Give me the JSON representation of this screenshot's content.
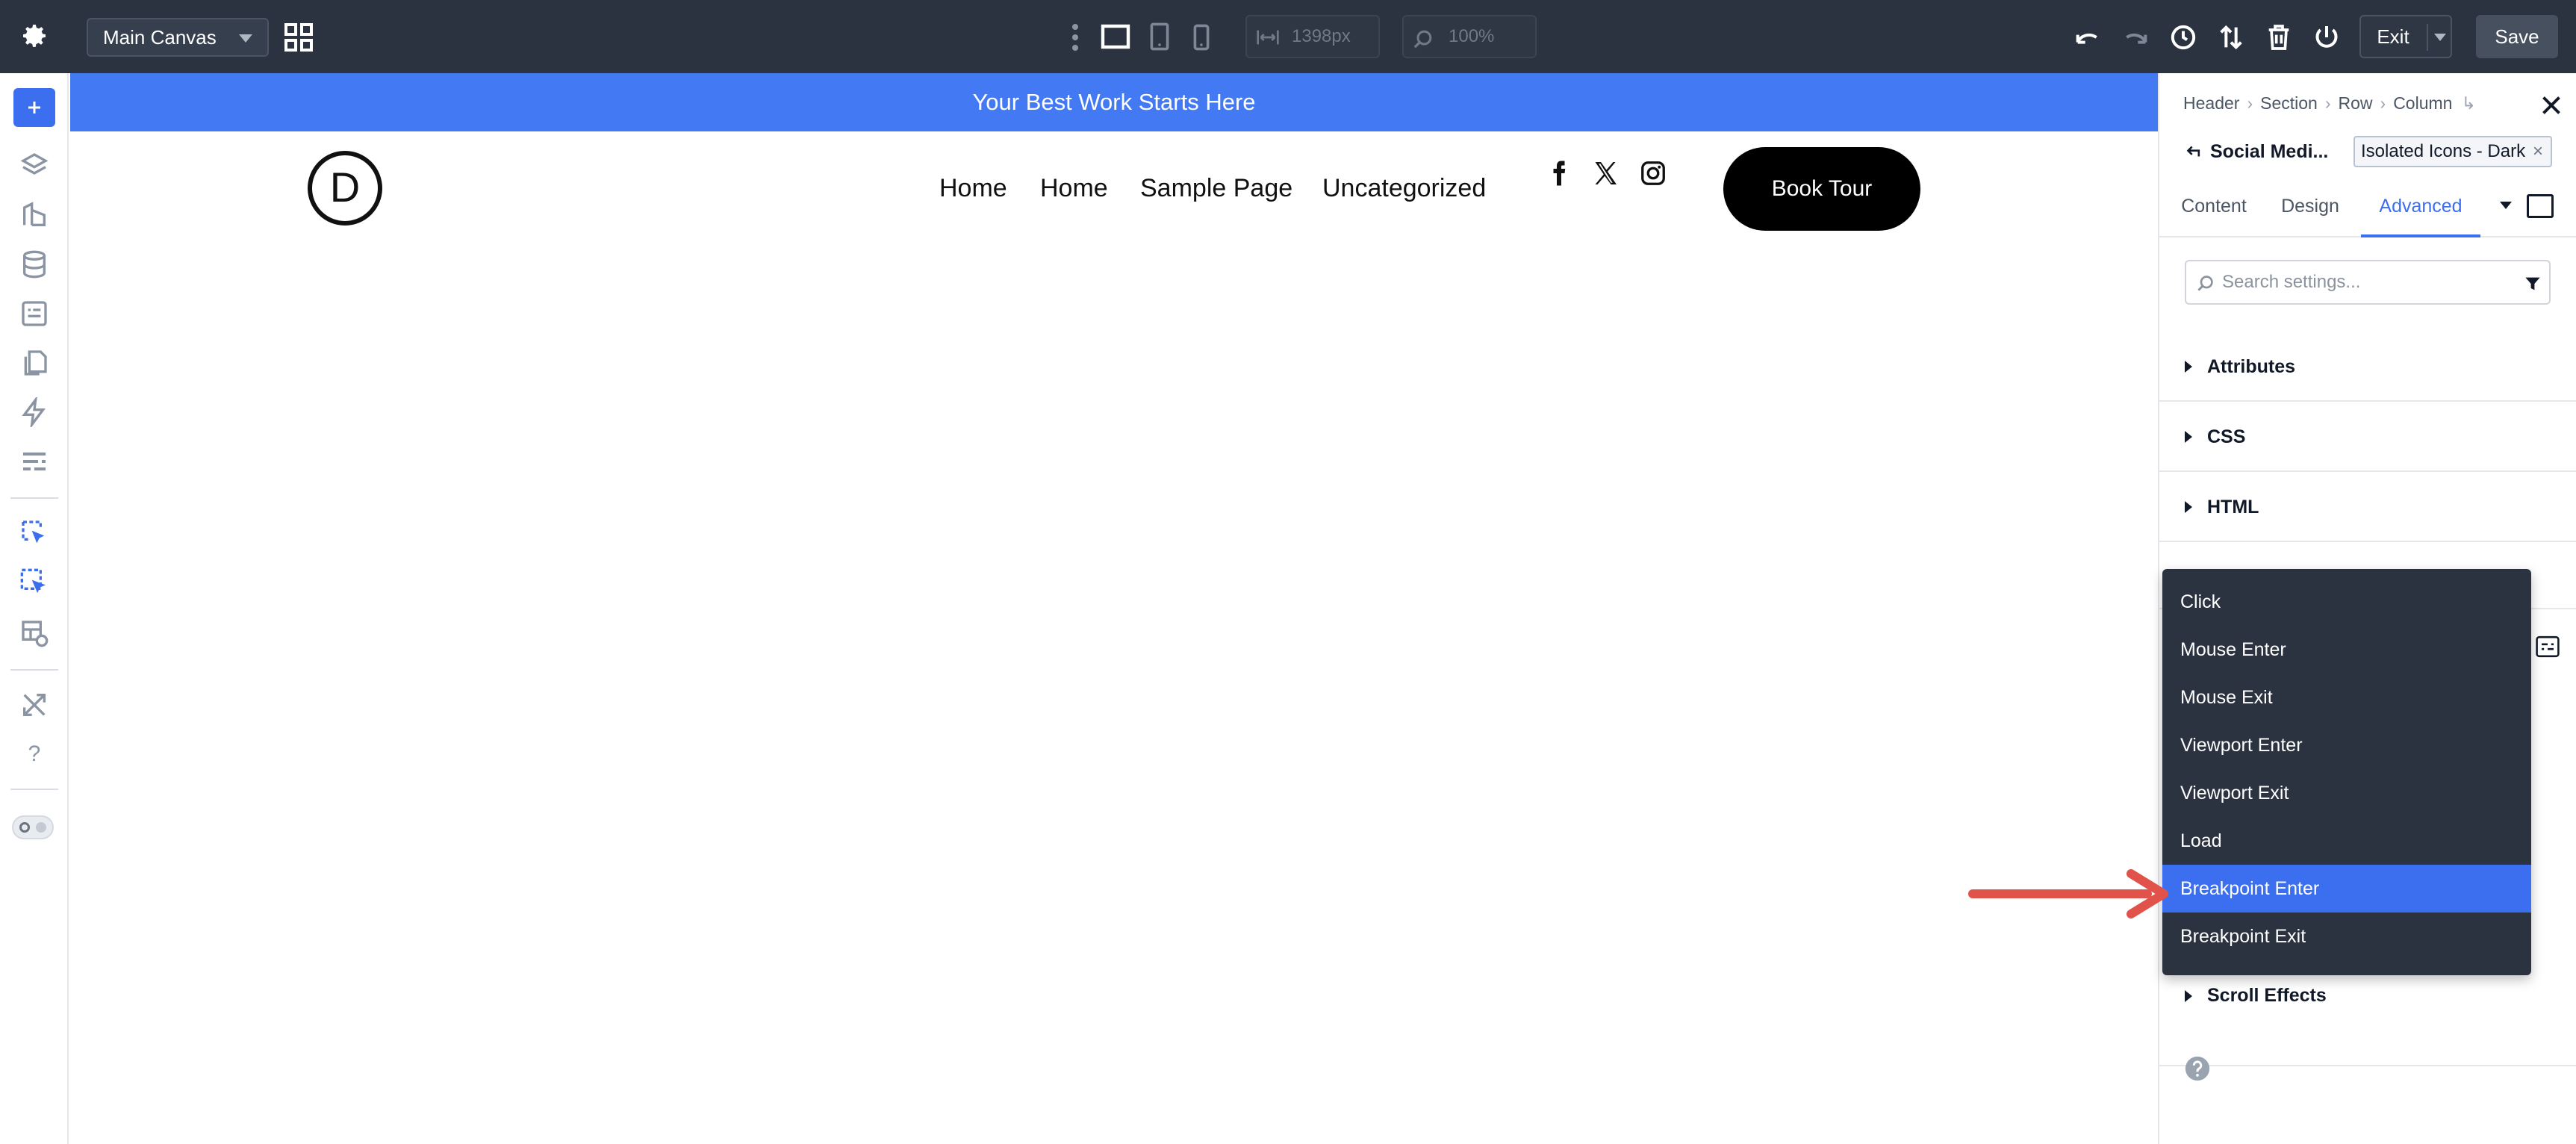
{
  "topbar": {
    "canvas_select": "Main Canvas",
    "width_value": "1398px",
    "zoom_value": "100%",
    "exit_label": "Exit",
    "save_label": "Save"
  },
  "page": {
    "announcement": "Your Best Work Starts Here",
    "logo_letter": "D",
    "nav_items": [
      "Home",
      "Home",
      "Sample Page",
      "Uncategorized"
    ],
    "social_icons": [
      "facebook-icon",
      "x-twitter-icon",
      "instagram-icon"
    ],
    "cta_label": "Book Tour"
  },
  "panel": {
    "breadcrumb": [
      "Header",
      "Section",
      "Row",
      "Column"
    ],
    "module_name": "Social Medi...",
    "preset_tag": "Isolated Icons - Dark",
    "tabs": [
      "Content",
      "Design",
      "Advanced"
    ],
    "active_tab": "Advanced",
    "search_placeholder": "Search settings...",
    "sections": [
      "Attributes",
      "CSS",
      "HTML",
      "Scroll Effects"
    ]
  },
  "dropdown": {
    "items": [
      "Click",
      "Mouse Enter",
      "Mouse Exit",
      "Viewport Enter",
      "Viewport Exit",
      "Load",
      "Breakpoint Enter",
      "Breakpoint Exit"
    ],
    "selected": "Breakpoint Enter"
  },
  "colors": {
    "topbar_bg": "#2b3340",
    "accent": "#3b6ff0",
    "announcement_bg": "#4379f2",
    "annotation_arrow": "#e0524a"
  }
}
